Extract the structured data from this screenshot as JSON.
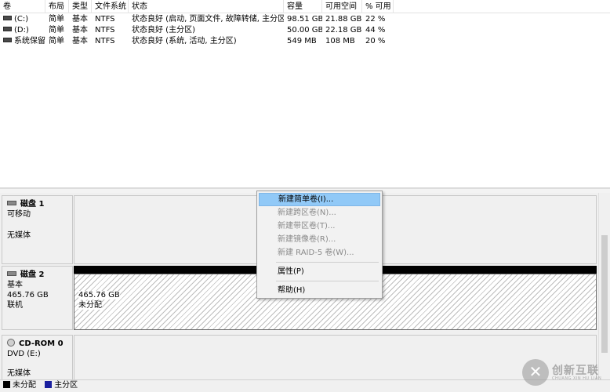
{
  "volume_list": {
    "columns": [
      "卷",
      "布局",
      "类型",
      "文件系统",
      "状态",
      "容量",
      "可用空间",
      "% 可用"
    ],
    "rows": [
      {
        "name": "(C:)",
        "layout": "简单",
        "type": "基本",
        "fs": "NTFS",
        "status": "状态良好 (启动, 页面文件, 故障转储, 主分区)",
        "capacity": "98.51 GB",
        "free": "21.88 GB",
        "pct": "22 %"
      },
      {
        "name": "(D:)",
        "layout": "简单",
        "type": "基本",
        "fs": "NTFS",
        "status": "状态良好 (主分区)",
        "capacity": "50.00 GB",
        "free": "22.18 GB",
        "pct": "44 %"
      },
      {
        "name": "系统保留",
        "layout": "简单",
        "type": "基本",
        "fs": "NTFS",
        "status": "状态良好 (系统, 活动, 主分区)",
        "capacity": "549 MB",
        "free": "108 MB",
        "pct": "20 %"
      }
    ]
  },
  "disks": [
    {
      "name": "磁盘 1",
      "type": "可移动",
      "size": "",
      "state": "无媒体",
      "icon": "disk-icon"
    },
    {
      "name": "磁盘 2",
      "type": "基本",
      "size": "465.76 GB",
      "state": "联机",
      "icon": "disk-icon",
      "partition": {
        "size": "465.76 GB",
        "status": "未分配"
      }
    },
    {
      "name": "CD-ROM 0",
      "type": "DVD (E:)",
      "size": "",
      "state": "无媒体",
      "icon": "cd-icon"
    }
  ],
  "context_menu": {
    "items": [
      {
        "label": "新建简单卷(I)...",
        "enabled": true,
        "highlighted": true
      },
      {
        "label": "新建跨区卷(N)...",
        "enabled": false
      },
      {
        "label": "新建带区卷(T)...",
        "enabled": false
      },
      {
        "label": "新建镜像卷(R)...",
        "enabled": false
      },
      {
        "label": "新建 RAID-5 卷(W)...",
        "enabled": false
      },
      {
        "label": "属性(P)",
        "enabled": true
      },
      {
        "label": "帮助(H)",
        "enabled": true
      }
    ]
  },
  "legend": [
    {
      "label": "未分配",
      "color": "#000000"
    },
    {
      "label": "主分区",
      "color": "#1a1f9e"
    }
  ],
  "watermark": {
    "title": "创新互联",
    "subtitle": "CHUANG XIN HU LIAN"
  },
  "colors": {
    "highlight": "#91c9f7",
    "unallocated": "#000000",
    "primary_partition": "#1a1f9e"
  }
}
